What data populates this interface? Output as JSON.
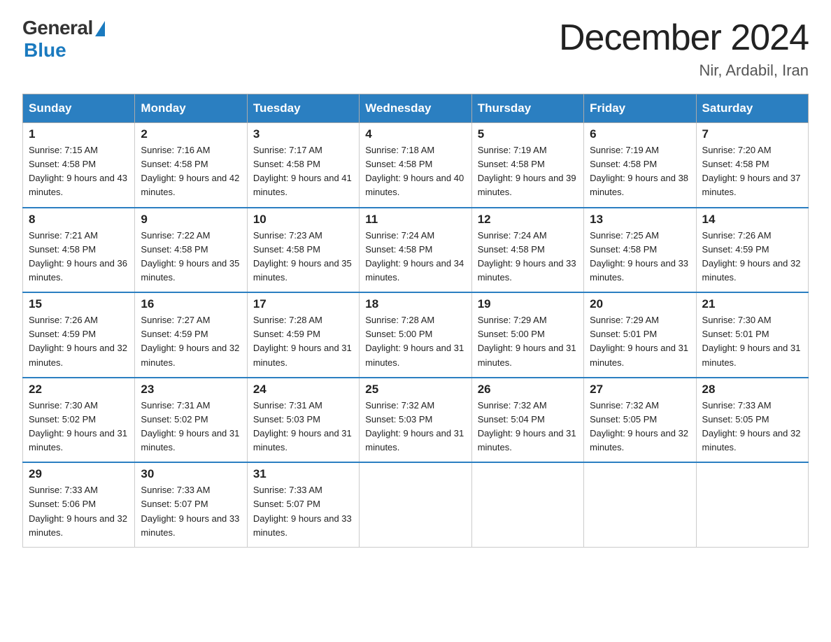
{
  "header": {
    "logo_general": "General",
    "logo_blue": "Blue",
    "month_title": "December 2024",
    "location": "Nir, Ardabil, Iran"
  },
  "calendar": {
    "days_of_week": [
      "Sunday",
      "Monday",
      "Tuesday",
      "Wednesday",
      "Thursday",
      "Friday",
      "Saturday"
    ],
    "weeks": [
      [
        {
          "day": "1",
          "sunrise": "7:15 AM",
          "sunset": "4:58 PM",
          "daylight": "9 hours and 43 minutes."
        },
        {
          "day": "2",
          "sunrise": "7:16 AM",
          "sunset": "4:58 PM",
          "daylight": "9 hours and 42 minutes."
        },
        {
          "day": "3",
          "sunrise": "7:17 AM",
          "sunset": "4:58 PM",
          "daylight": "9 hours and 41 minutes."
        },
        {
          "day": "4",
          "sunrise": "7:18 AM",
          "sunset": "4:58 PM",
          "daylight": "9 hours and 40 minutes."
        },
        {
          "day": "5",
          "sunrise": "7:19 AM",
          "sunset": "4:58 PM",
          "daylight": "9 hours and 39 minutes."
        },
        {
          "day": "6",
          "sunrise": "7:19 AM",
          "sunset": "4:58 PM",
          "daylight": "9 hours and 38 minutes."
        },
        {
          "day": "7",
          "sunrise": "7:20 AM",
          "sunset": "4:58 PM",
          "daylight": "9 hours and 37 minutes."
        }
      ],
      [
        {
          "day": "8",
          "sunrise": "7:21 AM",
          "sunset": "4:58 PM",
          "daylight": "9 hours and 36 minutes."
        },
        {
          "day": "9",
          "sunrise": "7:22 AM",
          "sunset": "4:58 PM",
          "daylight": "9 hours and 35 minutes."
        },
        {
          "day": "10",
          "sunrise": "7:23 AM",
          "sunset": "4:58 PM",
          "daylight": "9 hours and 35 minutes."
        },
        {
          "day": "11",
          "sunrise": "7:24 AM",
          "sunset": "4:58 PM",
          "daylight": "9 hours and 34 minutes."
        },
        {
          "day": "12",
          "sunrise": "7:24 AM",
          "sunset": "4:58 PM",
          "daylight": "9 hours and 33 minutes."
        },
        {
          "day": "13",
          "sunrise": "7:25 AM",
          "sunset": "4:58 PM",
          "daylight": "9 hours and 33 minutes."
        },
        {
          "day": "14",
          "sunrise": "7:26 AM",
          "sunset": "4:59 PM",
          "daylight": "9 hours and 32 minutes."
        }
      ],
      [
        {
          "day": "15",
          "sunrise": "7:26 AM",
          "sunset": "4:59 PM",
          "daylight": "9 hours and 32 minutes."
        },
        {
          "day": "16",
          "sunrise": "7:27 AM",
          "sunset": "4:59 PM",
          "daylight": "9 hours and 32 minutes."
        },
        {
          "day": "17",
          "sunrise": "7:28 AM",
          "sunset": "4:59 PM",
          "daylight": "9 hours and 31 minutes."
        },
        {
          "day": "18",
          "sunrise": "7:28 AM",
          "sunset": "5:00 PM",
          "daylight": "9 hours and 31 minutes."
        },
        {
          "day": "19",
          "sunrise": "7:29 AM",
          "sunset": "5:00 PM",
          "daylight": "9 hours and 31 minutes."
        },
        {
          "day": "20",
          "sunrise": "7:29 AM",
          "sunset": "5:01 PM",
          "daylight": "9 hours and 31 minutes."
        },
        {
          "day": "21",
          "sunrise": "7:30 AM",
          "sunset": "5:01 PM",
          "daylight": "9 hours and 31 minutes."
        }
      ],
      [
        {
          "day": "22",
          "sunrise": "7:30 AM",
          "sunset": "5:02 PM",
          "daylight": "9 hours and 31 minutes."
        },
        {
          "day": "23",
          "sunrise": "7:31 AM",
          "sunset": "5:02 PM",
          "daylight": "9 hours and 31 minutes."
        },
        {
          "day": "24",
          "sunrise": "7:31 AM",
          "sunset": "5:03 PM",
          "daylight": "9 hours and 31 minutes."
        },
        {
          "day": "25",
          "sunrise": "7:32 AM",
          "sunset": "5:03 PM",
          "daylight": "9 hours and 31 minutes."
        },
        {
          "day": "26",
          "sunrise": "7:32 AM",
          "sunset": "5:04 PM",
          "daylight": "9 hours and 31 minutes."
        },
        {
          "day": "27",
          "sunrise": "7:32 AM",
          "sunset": "5:05 PM",
          "daylight": "9 hours and 32 minutes."
        },
        {
          "day": "28",
          "sunrise": "7:33 AM",
          "sunset": "5:05 PM",
          "daylight": "9 hours and 32 minutes."
        }
      ],
      [
        {
          "day": "29",
          "sunrise": "7:33 AM",
          "sunset": "5:06 PM",
          "daylight": "9 hours and 32 minutes."
        },
        {
          "day": "30",
          "sunrise": "7:33 AM",
          "sunset": "5:07 PM",
          "daylight": "9 hours and 33 minutes."
        },
        {
          "day": "31",
          "sunrise": "7:33 AM",
          "sunset": "5:07 PM",
          "daylight": "9 hours and 33 minutes."
        },
        null,
        null,
        null,
        null
      ]
    ]
  }
}
